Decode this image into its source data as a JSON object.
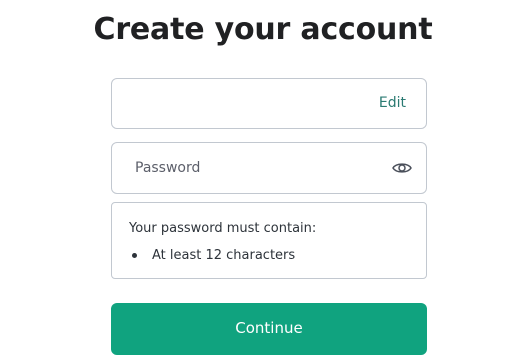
{
  "page": {
    "title": "Create your account"
  },
  "email_field": {
    "value": "",
    "edit_label": "Edit"
  },
  "password_field": {
    "placeholder": "Password",
    "value": "",
    "toggle_icon": "eye-icon"
  },
  "requirements": {
    "heading": "Your password must contain:",
    "items": [
      {
        "label": "At least 12 characters"
      }
    ]
  },
  "continue_button": {
    "label": "Continue"
  },
  "colors": {
    "accent": "#10a37f",
    "border": "#c2c8d0",
    "title": "#202123"
  }
}
